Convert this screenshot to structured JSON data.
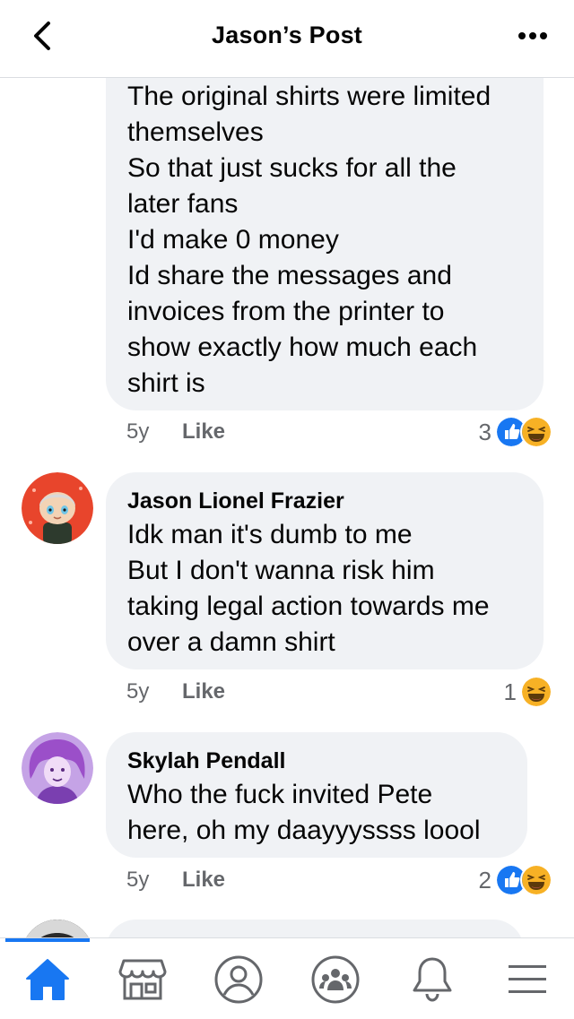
{
  "header": {
    "title": "Jason’s Post",
    "back_icon": "chevron-left-icon",
    "more_icon": "more-horizontal-icon"
  },
  "comments": [
    {
      "name": "",
      "text": "The original shirts were limited\nthemselves\nSo that just sucks for all the\nlater fans\nI'd make 0 money\nId share the messages and\ninvoices from the printer to\nshow exactly how much each\nshirt is",
      "time": "5y",
      "like": "Like",
      "reaction_count": "3",
      "reactions": [
        "like",
        "haha"
      ]
    },
    {
      "name": "Jason Lionel Frazier",
      "text": "Idk man it's dumb to me\nBut I don't wanna risk him\ntaking legal action towards me\nover a damn shirt",
      "time": "5y",
      "like": "Like",
      "reaction_count": "1",
      "reactions": [
        "haha"
      ]
    },
    {
      "name": "Skylah Pendall",
      "text": "Who the fuck invited Pete\nhere, oh my daayyyssss loool",
      "time": "5y",
      "like": "Like",
      "reaction_count": "2",
      "reactions": [
        "like",
        "haha"
      ]
    }
  ],
  "tabbar": {
    "tabs": [
      "home-icon",
      "marketplace-icon",
      "profile-icon",
      "groups-icon",
      "notifications-bell-icon",
      "menu-icon"
    ],
    "active_color": "#1877f2"
  }
}
